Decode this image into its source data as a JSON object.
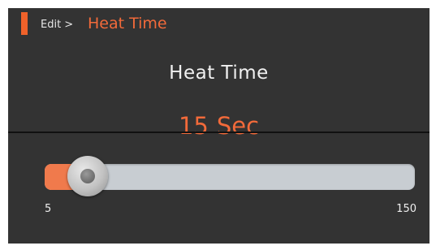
{
  "colors": {
    "background": "#333333",
    "accent": "#f26a3a",
    "track": "#c8cdd2",
    "text": "#f0f0f0"
  },
  "breadcrumb": {
    "parent": "Edit",
    "separator": ">",
    "current": "Heat Time"
  },
  "title": "Heat Time",
  "value": {
    "number": "15",
    "unit": "Sec"
  },
  "slider": {
    "min": 5,
    "max": 150,
    "value": 15,
    "min_label": "5",
    "max_label": "150"
  }
}
